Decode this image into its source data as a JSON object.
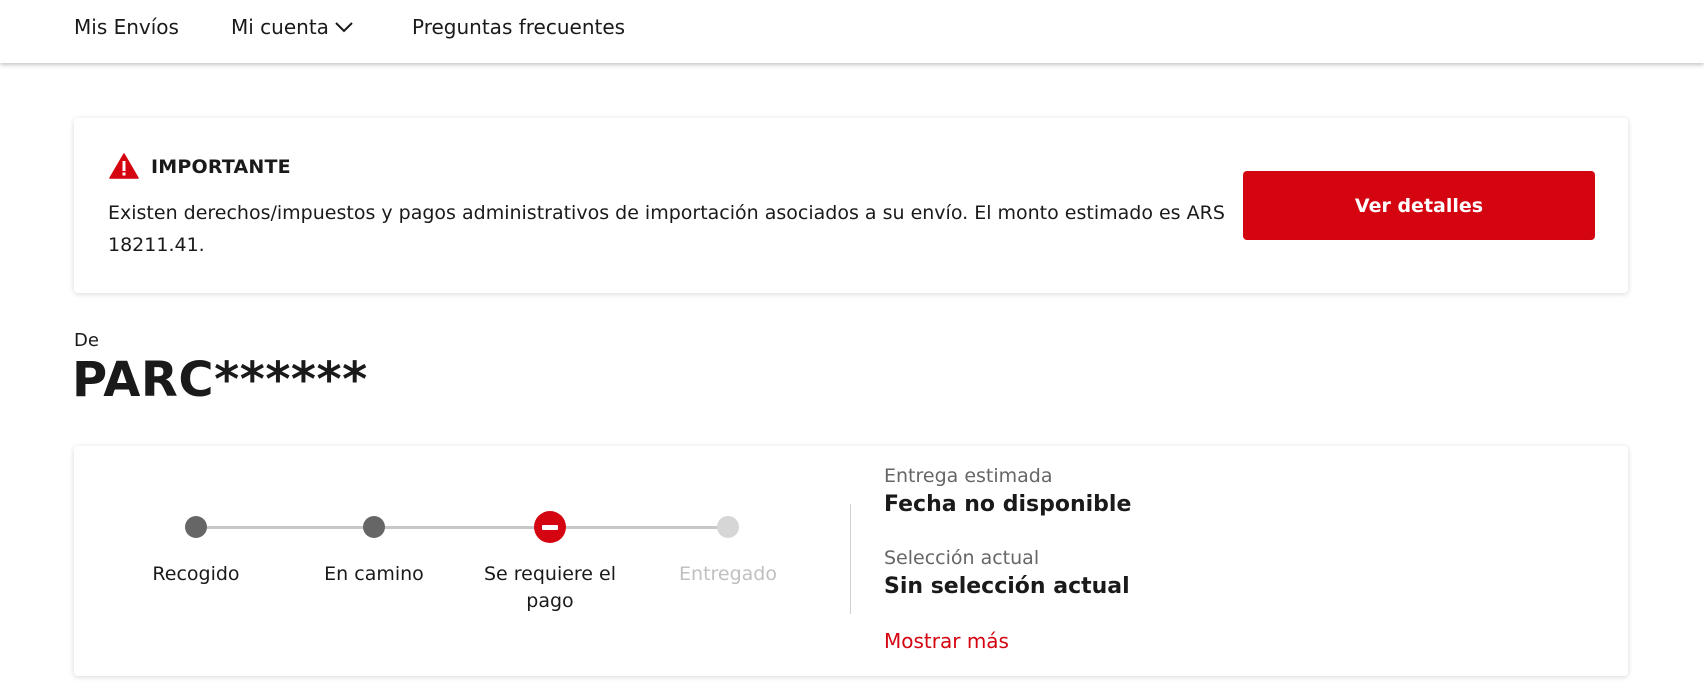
{
  "nav": {
    "items": [
      {
        "label": "Mis Envíos"
      },
      {
        "label": "Mi cuenta",
        "icon": "chevron-down-icon"
      },
      {
        "label": "Preguntas frecuentes"
      }
    ]
  },
  "alert": {
    "icon": "warning-triangle-icon",
    "title": "IMPORTANTE",
    "message": "Existen derechos/impuestos y pagos administrativos de importación asociados a su envío. El monto estimado es ARS 18211.41.",
    "button_label": "Ver detalles"
  },
  "sender": {
    "label": "De",
    "name": "PARC******"
  },
  "tracking": {
    "steps": [
      {
        "label": "Recogido",
        "status": "done"
      },
      {
        "label": "En camino",
        "status": "done"
      },
      {
        "label": "Se requiere el pago",
        "status": "alert"
      },
      {
        "label": "Entregado",
        "status": "pending"
      }
    ],
    "estimated_delivery_label": "Entrega estimada",
    "estimated_delivery_value": "Fecha no disponible",
    "current_selection_label": "Selección actual",
    "current_selection_value": "Sin selección actual",
    "show_more_label": "Mostrar más"
  },
  "colors": {
    "accent": "#d40511",
    "step_done": "#666666",
    "step_pending": "#d6d6d6"
  }
}
